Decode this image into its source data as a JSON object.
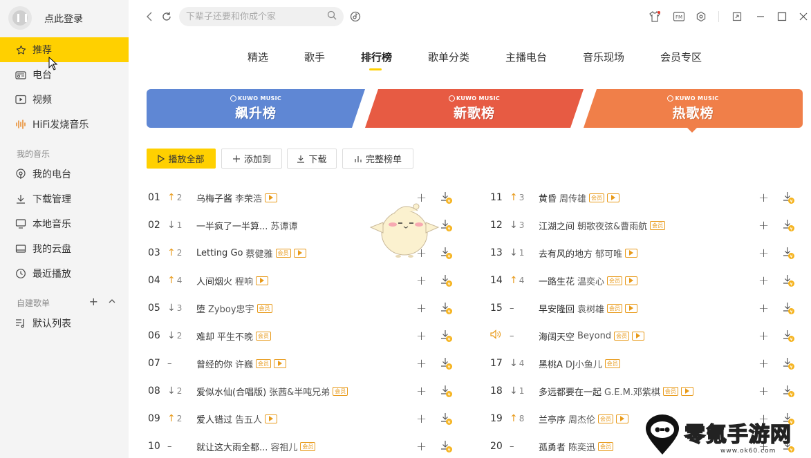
{
  "sidebar": {
    "login_text": "点此登录",
    "items": [
      {
        "label": "推荐",
        "icon": "star-icon",
        "active": true
      },
      {
        "label": "电台",
        "icon": "radio-icon"
      },
      {
        "label": "视频",
        "icon": "video-icon"
      },
      {
        "label": "HiFi发烧音乐",
        "icon": "waveform-icon"
      }
    ],
    "my_music_title": "我的音乐",
    "my_music": [
      {
        "label": "我的电台",
        "icon": "podcast-icon"
      },
      {
        "label": "下载管理",
        "icon": "download-icon"
      },
      {
        "label": "本地音乐",
        "icon": "monitor-icon"
      },
      {
        "label": "我的云盘",
        "icon": "cloud-icon"
      },
      {
        "label": "最近播放",
        "icon": "clock-icon"
      }
    ],
    "playlist_title": "自建歌单",
    "playlists": [
      {
        "label": "默认列表",
        "icon": "playlist-icon"
      }
    ]
  },
  "topbar": {
    "search_placeholder": "下辈子还要和你成个家"
  },
  "tabs": [
    "精选",
    "歌手",
    "排行榜",
    "歌单分类",
    "主播电台",
    "音乐现场",
    "会员专区"
  ],
  "active_tab": "排行榜",
  "banners": [
    {
      "brand": "KUWO MUSIC",
      "name": "飙升榜",
      "color": "#5f87d4"
    },
    {
      "brand": "KUWO MUSIC",
      "name": "新歌榜",
      "color": "#e75b43"
    },
    {
      "brand": "KUWO MUSIC",
      "name": "热歌榜",
      "color": "#f07f49"
    }
  ],
  "actions": {
    "play_all": "播放全部",
    "add_to": "添加到",
    "download": "下载",
    "full_chart": "完整榜单"
  },
  "songs": [
    {
      "rank": "01",
      "trend": "up",
      "delta": "2",
      "title": "乌梅子酱",
      "artist": "李荣浩",
      "vip": false,
      "mv": true
    },
    {
      "rank": "02",
      "trend": "down",
      "delta": "1",
      "title": "一半疯了一半算...",
      "artist": "苏谭谭",
      "vip": false,
      "mv": false
    },
    {
      "rank": "03",
      "trend": "up",
      "delta": "2",
      "title": "Letting Go",
      "artist": "蔡健雅",
      "vip": true,
      "mv": true
    },
    {
      "rank": "04",
      "trend": "up",
      "delta": "4",
      "title": "人间烟火",
      "artist": "程响",
      "vip": false,
      "mv": true
    },
    {
      "rank": "05",
      "trend": "down",
      "delta": "3",
      "title": "堕",
      "artist": "Zyboy忠宇",
      "vip": true,
      "mv": false
    },
    {
      "rank": "06",
      "trend": "down",
      "delta": "2",
      "title": "难却",
      "artist": "平生不晚",
      "vip": true,
      "mv": false
    },
    {
      "rank": "07",
      "trend": "same",
      "delta": "",
      "title": "曾经的你",
      "artist": "许巍",
      "vip": true,
      "mv": true
    },
    {
      "rank": "08",
      "trend": "down",
      "delta": "2",
      "title": "爱似水仙(合唱版)",
      "artist": "张茜&半吨兄弟",
      "vip": true,
      "mv": false
    },
    {
      "rank": "09",
      "trend": "up",
      "delta": "2",
      "title": "爱人错过",
      "artist": "告五人",
      "vip": false,
      "mv": true
    },
    {
      "rank": "10",
      "trend": "same",
      "delta": "",
      "title": "就让这大雨全都...",
      "artist": "容祖儿",
      "vip": true,
      "mv": false
    },
    {
      "rank": "11",
      "trend": "up",
      "delta": "3",
      "title": "黄昏",
      "artist": "周传雄",
      "vip": true,
      "mv": true
    },
    {
      "rank": "12",
      "trend": "down",
      "delta": "3",
      "title": "江湖之间",
      "artist": "朝歌夜弦&曹雨航",
      "vip": true,
      "mv": false
    },
    {
      "rank": "13",
      "trend": "down",
      "delta": "1",
      "title": "去有风的地方",
      "artist": "郁可唯",
      "vip": false,
      "mv": true
    },
    {
      "rank": "14",
      "trend": "up",
      "delta": "4",
      "title": "一路生花",
      "artist": "温奕心",
      "vip": true,
      "mv": true
    },
    {
      "rank": "15",
      "trend": "same",
      "delta": "",
      "title": "早安隆回",
      "artist": "袁树雄",
      "vip": true,
      "mv": true
    },
    {
      "rank": "",
      "playing": true,
      "trend": "same",
      "delta": "",
      "title": "海阔天空",
      "artist": "Beyond",
      "vip": true,
      "mv": true
    },
    {
      "rank": "17",
      "trend": "down",
      "delta": "4",
      "title": "黑桃A",
      "artist": "DJ小鱼儿",
      "vip": true,
      "mv": false
    },
    {
      "rank": "18",
      "trend": "down",
      "delta": "1",
      "title": "多远都要在一起",
      "artist": "G.E.M.邓紫棋",
      "vip": true,
      "mv": true
    },
    {
      "rank": "19",
      "trend": "up",
      "delta": "8",
      "title": "兰亭序",
      "artist": "周杰伦",
      "vip": true,
      "mv": true
    },
    {
      "rank": "20",
      "trend": "same",
      "delta": "",
      "title": "孤勇者",
      "artist": "陈奕迅",
      "vip": true,
      "mv": false
    }
  ],
  "tags": {
    "vip": "会员"
  },
  "watermark": {
    "text": "零氪手游网",
    "url": "www.ok60.com"
  }
}
